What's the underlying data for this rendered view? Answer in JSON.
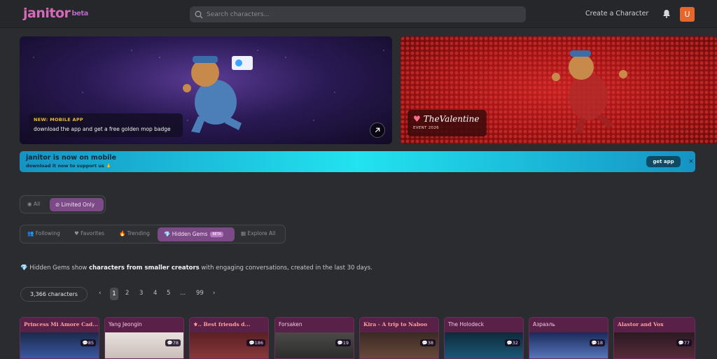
{
  "header": {
    "logo": "janitor",
    "logo_badge": "beta",
    "search_placeholder": "Search characters...",
    "create_label": "Create a Character",
    "avatar_letter": "U"
  },
  "banners": [
    {
      "tag": "NEW: MOBILE APP",
      "description": "download the app and get a free golden mop badge"
    },
    {
      "title": "TheValentine",
      "subtitle": "EVENT 2026"
    }
  ],
  "mobile_strip": {
    "title": "janitor is now on mobile",
    "subtitle": "download it now to support us 🙏",
    "button": "get app",
    "close": "×"
  },
  "filters": {
    "all": "All",
    "limited": "Limited Only"
  },
  "tabs": {
    "following": "Following",
    "favorites": "Favorites",
    "trending": "Trending",
    "hidden_gems": "Hidden Gems",
    "hidden_gems_badge": "BETA",
    "explore_all": "Explore All"
  },
  "hidden_gems_info": {
    "prefix": "Hidden Gems show ",
    "bold": "characters from smaller creators",
    "suffix": " with engaging conversations, created in the last 30 days."
  },
  "pagination": {
    "count": "3,366 characters",
    "prev": "‹",
    "pages": [
      "1",
      "2",
      "3",
      "4",
      "5",
      "...",
      "99"
    ],
    "next": "›"
  },
  "cards": [
    {
      "title": "Princess Mi Amore Cad...",
      "count": "85"
    },
    {
      "title": "Yang Jeongin",
      "count": "78"
    },
    {
      "title": "⚜.. Best friends d...",
      "count": "186"
    },
    {
      "title": "Forsaken",
      "count": "19"
    },
    {
      "title": "Kira - A trip to Naboo",
      "count": "38"
    },
    {
      "title": "The Holodeck",
      "count": "32"
    },
    {
      "title": "Азраэль",
      "count": "18"
    },
    {
      "title": "Alastor and Vox",
      "count": "77"
    }
  ]
}
